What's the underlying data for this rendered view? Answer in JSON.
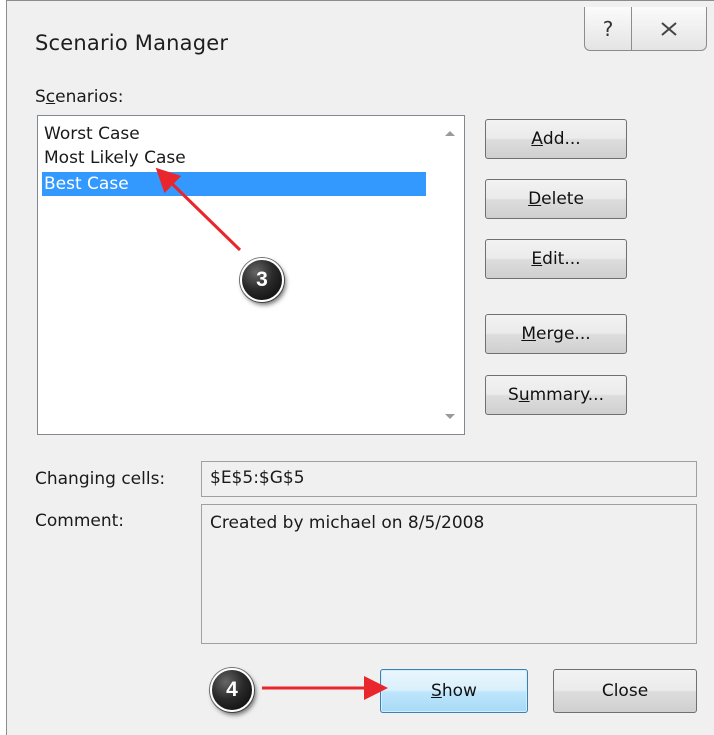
{
  "window": {
    "title": "Scenario Manager",
    "help_glyph": "?",
    "close_icon": "close-icon"
  },
  "scenarios": {
    "label_prefix": "S",
    "label_mnemonic": "c",
    "label_suffix": "enarios:",
    "items": [
      {
        "label": "Worst Case",
        "selected": false
      },
      {
        "label": "Most Likely Case",
        "selected": false
      },
      {
        "label": "Best Case",
        "selected": true
      }
    ]
  },
  "buttons": {
    "add": {
      "mnemonic": "A",
      "rest": "dd..."
    },
    "delete": {
      "mnemonic": "D",
      "rest": "elete"
    },
    "edit": {
      "mnemonic": "E",
      "rest": "dit..."
    },
    "merge": {
      "mnemonic": "M",
      "rest": "erge..."
    },
    "summary": {
      "prefix": "S",
      "mnemonic": "u",
      "rest": "mmary..."
    },
    "show": {
      "mnemonic": "S",
      "rest": "how"
    },
    "close": "Close"
  },
  "changing_cells": {
    "label": "Changing cells:",
    "value": "$E$5:$G$5"
  },
  "comment": {
    "label": "Comment:",
    "value": "Created by michael on 8/5/2008"
  },
  "annotations": {
    "step3": "3",
    "step4": "4",
    "arrow_color": "#e8262b"
  },
  "colors": {
    "selection": "#3399ff",
    "dialog_bg": "#f0f0f0"
  }
}
